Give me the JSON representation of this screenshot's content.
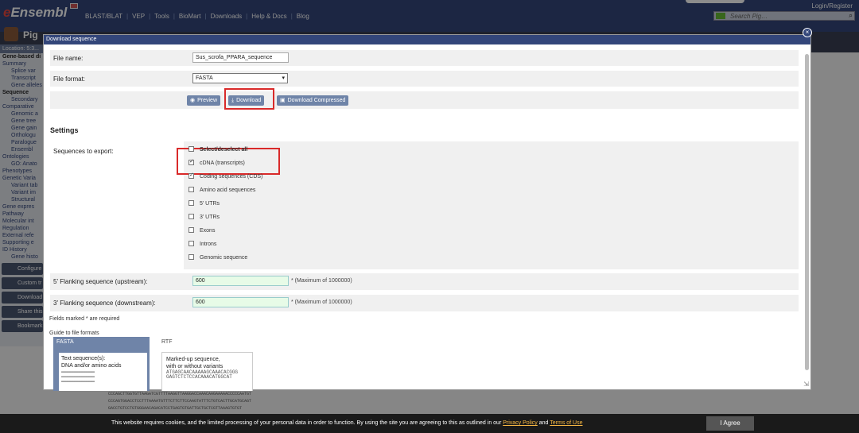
{
  "header": {
    "logo": "Ensembl",
    "nav": [
      "BLAST/BLAT",
      "VEP",
      "Tools",
      "BioMart",
      "Downloads",
      "Help & Docs",
      "Blog"
    ],
    "login": "Login/Register",
    "search_placeholder": "Search Pig…"
  },
  "species": {
    "name": "Pig"
  },
  "sidebar": {
    "location": "Location: 5:3...",
    "items": [
      {
        "label": "Gene-based di",
        "style": "bold"
      },
      {
        "label": "Summary",
        "style": ""
      },
      {
        "label": "Splice var",
        "style": "sub"
      },
      {
        "label": "Transcript",
        "style": "sub"
      },
      {
        "label": "Gene alleles",
        "style": "sub"
      },
      {
        "label": "Sequence",
        "style": "bold"
      },
      {
        "label": "Secondary",
        "style": "sub"
      },
      {
        "label": "Comparative",
        "style": ""
      },
      {
        "label": "Genomic a",
        "style": "sub"
      },
      {
        "label": "Gene tree",
        "style": "sub"
      },
      {
        "label": "Gene gain",
        "style": "sub"
      },
      {
        "label": "Orthologu",
        "style": "sub"
      },
      {
        "label": "Paralogue",
        "style": "sub"
      },
      {
        "label": "Ensembl",
        "style": "sub"
      },
      {
        "label": "Ontologies",
        "style": ""
      },
      {
        "label": "GO: Anato",
        "style": "sub"
      },
      {
        "label": "Phenotypes",
        "style": ""
      },
      {
        "label": "Genetic Varia",
        "style": ""
      },
      {
        "label": "Variant tab",
        "style": "sub"
      },
      {
        "label": "Variant im",
        "style": "sub"
      },
      {
        "label": "Structural",
        "style": "sub"
      },
      {
        "label": "Gene expres",
        "style": ""
      },
      {
        "label": "Pathway",
        "style": ""
      },
      {
        "label": "Molecular int",
        "style": ""
      },
      {
        "label": "Regulation",
        "style": ""
      },
      {
        "label": "External refe",
        "style": ""
      },
      {
        "label": "Supporting e",
        "style": ""
      },
      {
        "label": "ID History",
        "style": ""
      },
      {
        "label": "Gene histo",
        "style": "sub"
      }
    ],
    "buttons": [
      "Configure",
      "Custom tr",
      "Download",
      "Share this",
      "Bookmark"
    ]
  },
  "modal": {
    "title": "Download sequence",
    "file_name_label": "File name:",
    "file_name_value": "Sus_scrofa_PPARA_sequence",
    "file_format_label": "File format:",
    "file_format_value": "FASTA",
    "buttons": {
      "preview": "Preview",
      "download": "Download",
      "download_compressed": "Download Compressed"
    },
    "settings_heading": "Settings",
    "sequences_label": "Sequences to export:",
    "checkboxes": [
      {
        "label": "Select/deselect all",
        "checked": false,
        "bold": true
      },
      {
        "label": "cDNA (transcripts)",
        "checked": true,
        "bold": false
      },
      {
        "label": "Coding sequences (CDS)",
        "checked": true,
        "bold": false
      },
      {
        "label": "Amino acid sequences",
        "checked": false,
        "bold": false
      },
      {
        "label": "5' UTRs",
        "checked": false,
        "bold": false
      },
      {
        "label": "3' UTRs",
        "checked": false,
        "bold": false
      },
      {
        "label": "Exons",
        "checked": false,
        "bold": false
      },
      {
        "label": "Introns",
        "checked": false,
        "bold": false
      },
      {
        "label": "Genomic sequence",
        "checked": false,
        "bold": false
      }
    ],
    "flank_up_label": "5' Flanking sequence (upstream):",
    "flank_up_value": "600",
    "flank_up_hint": "* (Maximum of 1000000)",
    "flank_down_label": "3' Flanking sequence (downstream):",
    "flank_down_value": "600",
    "flank_down_hint": "* (Maximum of 1000000)",
    "required_note": "Fields marked * are required",
    "guide_label": "Guide to file formats",
    "fasta_card": {
      "title": "FASTA",
      "desc1": "Text sequence(s):",
      "desc2": "DNA and/or amino acids"
    },
    "rtf_card": {
      "title": "RTF",
      "desc1": "Marked-up sequence,",
      "desc2": "with or without variants",
      "seq1": "ATGAGCAACAAAAAGCAAACACGGG",
      "seq2": "GAGTCTCTCCACAAACATGGCAT"
    }
  },
  "background_sequence": [
    "CCCAGCTTGGTGTTAAGATCGTTTTAAGGTTAAGGACCAAACAAGAAAAACCCCCAATGT",
    "CCCAGTGGACCTCCTTTAAAATGTTTCTTCTTCCAAGTATTTCTGTCACTTGCATGCAGT",
    "GACCTGTCCTGTGGGAACAGACATCCTGAGTGTGATTGCTGCTCGTTAAAGTGTGT"
  ],
  "cookie": {
    "text_before": "This website requires cookies, and the limited processing of your personal data in order to function. By using the site you are agreeing to this as outlined in our ",
    "privacy": "Privacy Policy",
    "and": " and ",
    "terms": "Terms of Use",
    "agree": "I Agree"
  }
}
